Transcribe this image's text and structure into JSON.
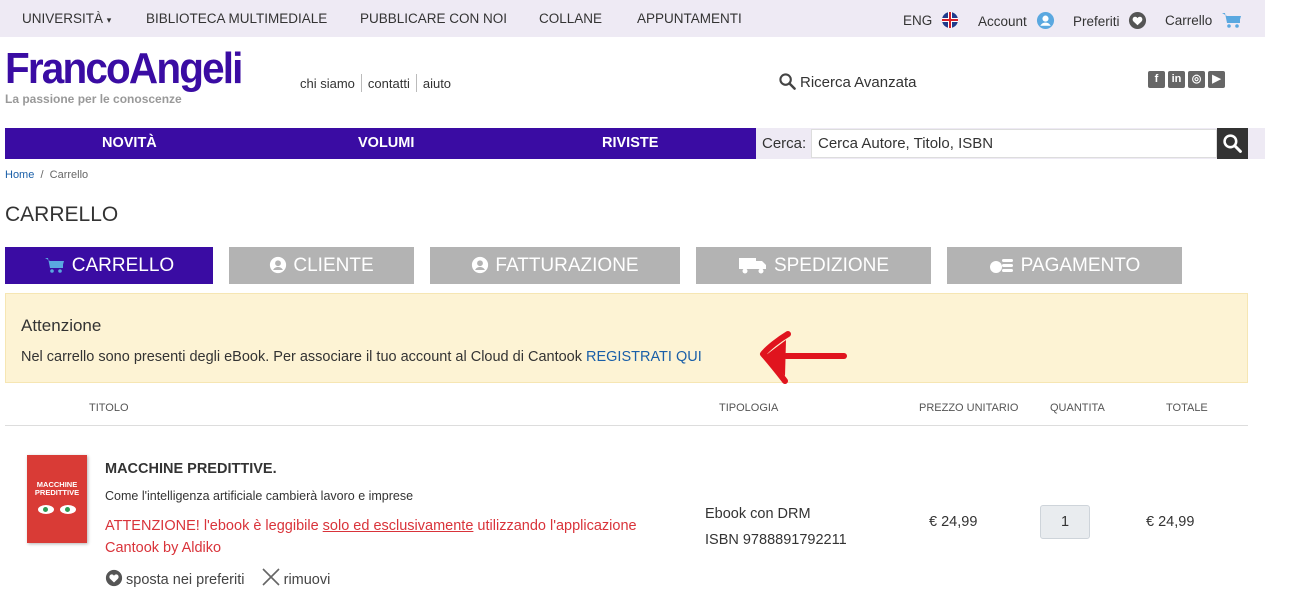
{
  "topbar": {
    "universita": "UNIVERSITÀ",
    "biblioteca": "BIBLIOTECA MULTIMEDIALE",
    "pubblicare": "PUBBLICARE CON NOI",
    "collane": "COLLANE",
    "appuntamenti": "APPUNTAMENTI",
    "lang": "ENG",
    "account": "Account",
    "preferiti": "Preferiti",
    "carrello": "Carrello"
  },
  "logo": {
    "brand": "FrancoAngeli",
    "tagline": "La passione per le conoscenze"
  },
  "links": [
    "chi siamo",
    "contatti",
    "aiuto"
  ],
  "advanced_search": "Ricerca Avanzata",
  "nav": {
    "novita": "NOVITÀ",
    "volumi": "VOLUMI",
    "riviste": "RIVISTE"
  },
  "search": {
    "label": "Cerca:",
    "placeholder": "Cerca Autore, Titolo, ISBN"
  },
  "breadcrumb": {
    "home": "Home",
    "sep": "/",
    "current": "Carrello"
  },
  "page_title": "CARRELLO",
  "steps": [
    "CARRELLO",
    "CLIENTE",
    "FATTURAZIONE",
    "SPEDIZIONE",
    "PAGAMENTO"
  ],
  "alert": {
    "heading": "Attenzione",
    "text": "Nel carrello sono presenti degli eBook. Per associare il tuo account al Cloud di Cantook ",
    "link": "REGISTRATI QUI"
  },
  "table_headers": {
    "titolo": "TITOLO",
    "tipologia": "TIPOLOGIA",
    "prezzo": "PREZZO UNITARIO",
    "quantita": "QUANTITA",
    "totale": "TOTALE"
  },
  "item": {
    "cover_title": "MACCHINE PREDITTIVE",
    "title": "MACCHINE PREDITTIVE.",
    "subtitle": "Come l'intelligenza artificiale cambierà lavoro e imprese",
    "warn_a": "ATTENZIONE! l'ebook è leggibile ",
    "warn_u": "solo ed esclusivamente",
    "warn_b": " utilizzando l'applicazione Cantook by Aldiko",
    "move_fav": "sposta nei preferiti",
    "remove": "rimuovi",
    "type": "Ebook con DRM",
    "isbn": "ISBN  9788891792211",
    "price": "€ 24,99",
    "qty": "1",
    "total": "€ 24,99"
  },
  "colors": {
    "brand": "#3a0ca3",
    "alert_bg": "#fdf3d4",
    "warn": "#d9333a",
    "arrow": "#e0141e"
  }
}
